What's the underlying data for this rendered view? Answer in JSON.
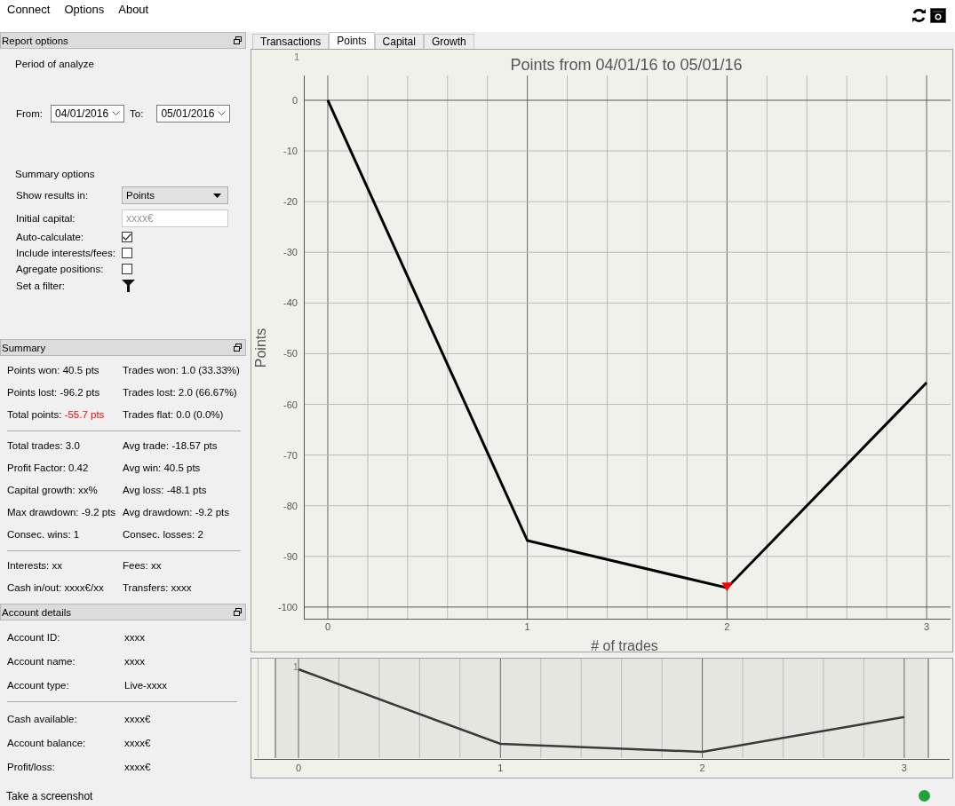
{
  "menu": [
    "Connect",
    "Options",
    "About"
  ],
  "report_options": {
    "title": "Report options",
    "period_label": "Period of analyze",
    "from": {
      "label": "From:",
      "value": "04/01/2016"
    },
    "to": {
      "label": "To:",
      "value": "05/01/2016"
    },
    "summary_label": "Summary options",
    "show_results": {
      "label": "Show results in:",
      "value": "Points"
    },
    "initial_capital": {
      "label": "Initial capital:",
      "placeholder": "xxxx€"
    },
    "checkboxes": [
      {
        "label": "Auto-calculate:",
        "checked": true
      },
      {
        "label": "Include interests/fees:",
        "checked": false
      },
      {
        "label": "Agregate positions:",
        "checked": false
      }
    ],
    "filter": {
      "label": "Set a filter:"
    }
  },
  "summary": {
    "title": "Summary",
    "groups": [
      {
        "cells": [
          {
            "label": "Points won:",
            "value": "40.5 pts",
            "highlight": false
          },
          {
            "label": "Trades won:",
            "value": "1.0 (33.33%)",
            "highlight": false
          },
          {
            "label": "Points lost:",
            "value": "-96.2 pts",
            "highlight": false
          },
          {
            "label": "Trades lost:",
            "value": "2.0 (66.67%)",
            "highlight": false
          },
          {
            "label": "Total points:",
            "value": "-55.7 pts",
            "highlight": true
          },
          {
            "label": "Trades flat:",
            "value": "0.0 (0.0%)",
            "highlight": false
          }
        ]
      },
      {
        "cells": [
          {
            "label": "Total trades:",
            "value": "3.0",
            "highlight": false
          },
          {
            "label": "Avg trade:",
            "value": "-18.57 pts",
            "highlight": false
          },
          {
            "label": "Profit Factor:",
            "value": "0.42",
            "highlight": false
          },
          {
            "label": "Avg win:",
            "value": "40.5 pts",
            "highlight": false
          },
          {
            "label": "Capital growth:",
            "value": "xx%",
            "highlight": false
          },
          {
            "label": "Avg loss:",
            "value": "-48.1 pts",
            "highlight": false
          },
          {
            "label": "Max drawdown:",
            "value": "-9.2 pts",
            "highlight": false
          },
          {
            "label": "Avg drawdown:",
            "value": "-9.2 pts",
            "highlight": false
          },
          {
            "label": "Consec. wins:",
            "value": "1",
            "highlight": false
          },
          {
            "label": "Consec. losses:",
            "value": "2",
            "highlight": false
          }
        ]
      },
      {
        "cells": [
          {
            "label": "Interests:",
            "value": "xx",
            "highlight": false
          },
          {
            "label": "Fees:",
            "value": "xx",
            "highlight": false
          },
          {
            "label": "Cash in/out:",
            "value": "xxxx€/xx",
            "highlight": false
          },
          {
            "label": "Transfers:",
            "value": "xxxx",
            "highlight": false
          }
        ]
      }
    ]
  },
  "account": {
    "title": "Account details",
    "groups": [
      {
        "rows": [
          {
            "label": "Account ID:",
            "value": "xxxx"
          },
          {
            "label": "Account name:",
            "value": "xxxx"
          },
          {
            "label": "Account type:",
            "value": "Live-xxxx"
          }
        ]
      },
      {
        "rows": [
          {
            "label": "Cash available:",
            "value": "xxxx€"
          },
          {
            "label": "Account balance:",
            "value": "xxxx€"
          },
          {
            "label": "Profit/loss:",
            "value": "xxxx€"
          }
        ]
      }
    ]
  },
  "tabs": [
    {
      "label": "Transactions",
      "selected": false
    },
    {
      "label": "Points",
      "selected": true
    },
    {
      "label": "Capital",
      "selected": false
    },
    {
      "label": "Growth",
      "selected": false
    }
  ],
  "chart": {
    "corner_label": "1",
    "chart_data": {
      "type": "line",
      "title": "Points from 04/01/16 to 05/01/16",
      "xlabel": "# of trades",
      "ylabel": "Points",
      "x": [
        0,
        1,
        2,
        3
      ],
      "series": [
        {
          "color": "#000000",
          "values": [
            0,
            -86.9,
            -96.2,
            -55.7
          ]
        }
      ],
      "xlim": [
        -0.12,
        3.12
      ],
      "ylim": [
        -102.3,
        4.9
      ],
      "grid": true,
      "xticks": [
        0,
        1,
        2,
        3
      ],
      "yticks": [
        0,
        -10,
        -20,
        -30,
        -40,
        -50,
        -60,
        -70,
        -80,
        -90,
        -100
      ]
    }
  },
  "overview": {
    "corner_label": "1",
    "xtick_labels": [
      "0",
      "1",
      "2",
      "3"
    ]
  },
  "status_bar": {
    "text": "Take a screenshot",
    "connected": true
  }
}
